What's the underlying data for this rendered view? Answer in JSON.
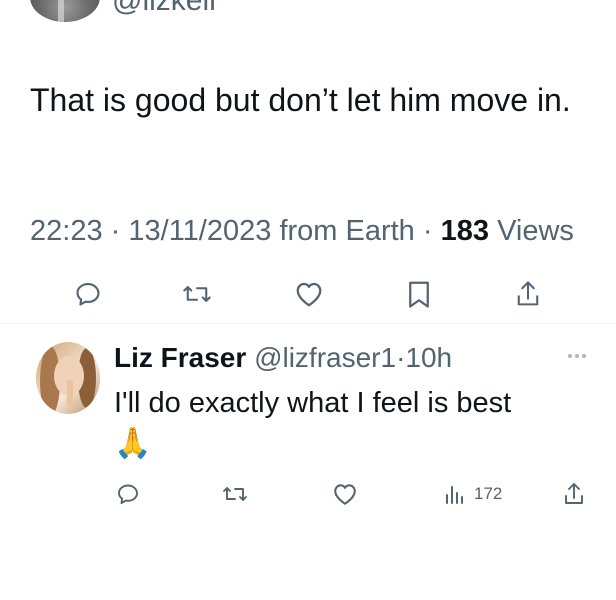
{
  "main_tweet": {
    "author_handle": "@lizkeir",
    "text": "That is good but don’t let him move in.",
    "time": "22:23",
    "sep1": "·",
    "date": "13/11/2023",
    "source": "from Earth",
    "sep2": "·",
    "views_count": "183",
    "views_label": "Views"
  },
  "main_actions": {
    "icons": [
      "reply-icon",
      "retweet-icon",
      "like-icon",
      "bookmark-icon",
      "share-icon"
    ]
  },
  "reply": {
    "name": "Liz Fraser",
    "handle": "@lizfraser1",
    "sep": "·",
    "age": "10h",
    "text": "I'll do exactly what I feel is best",
    "emoji": "🙏",
    "views": "172",
    "icons": [
      "reply-icon",
      "retweet-icon",
      "like-icon",
      "views-icon",
      "share-icon",
      "more-icon"
    ]
  },
  "colors": {
    "text": "#0f1419",
    "muted": "#536471",
    "divider": "#eff3f4"
  }
}
